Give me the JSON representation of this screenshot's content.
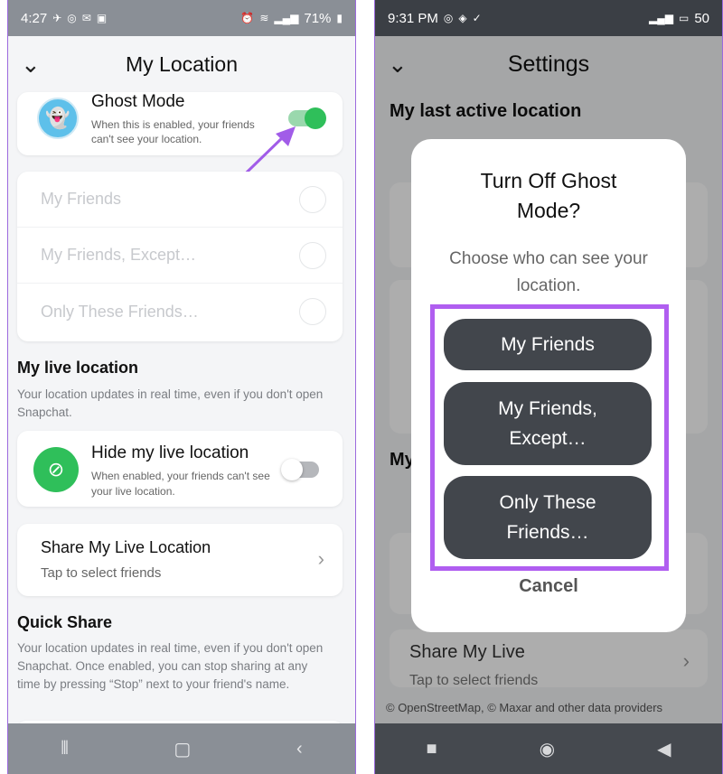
{
  "left": {
    "status": {
      "time": "4:27",
      "battery": "71%"
    },
    "header": {
      "title": "My Location"
    },
    "ghost": {
      "title": "Ghost Mode",
      "desc": "When this is enabled, your friends can't see your location.",
      "enabled": true
    },
    "options": [
      "My Friends",
      "My Friends, Except…",
      "Only These Friends…"
    ],
    "live": {
      "title": "My live location",
      "desc": "Your location updates in real time, even if you don't open Snapchat."
    },
    "hide": {
      "title": "Hide my live location",
      "desc": "When enabled, your friends can't see your live location.",
      "enabled": false
    },
    "share": {
      "title": "Share My Live Location",
      "sub": "Tap to select friends"
    },
    "quick": {
      "title": "Quick Share",
      "desc": "Your location updates in real time, even if you don't open Snapchat. Once enabled, you can stop sharing at any time by pressing “Stop” next to your friend's name."
    }
  },
  "right": {
    "status": {
      "time": "9:31 PM",
      "battery": "50"
    },
    "header": {
      "title": "Settings"
    },
    "last_active": {
      "title": "My last active location"
    },
    "partial_section": "My",
    "share": {
      "title": "Share My Live",
      "sub": "Tap to select friends"
    },
    "attribution": "© OpenStreetMap, © Maxar and other data providers",
    "dialog": {
      "title": "Turn Off Ghost Mode?",
      "desc": "Choose who can see your location.",
      "buttons": [
        "My Friends",
        "My Friends, Except…",
        "Only These Friends…"
      ],
      "cancel": "Cancel"
    }
  },
  "colors": {
    "accent_green": "#2fbf5a",
    "highlight_purple": "#b05ef0",
    "dialog_button": "#42464c"
  }
}
